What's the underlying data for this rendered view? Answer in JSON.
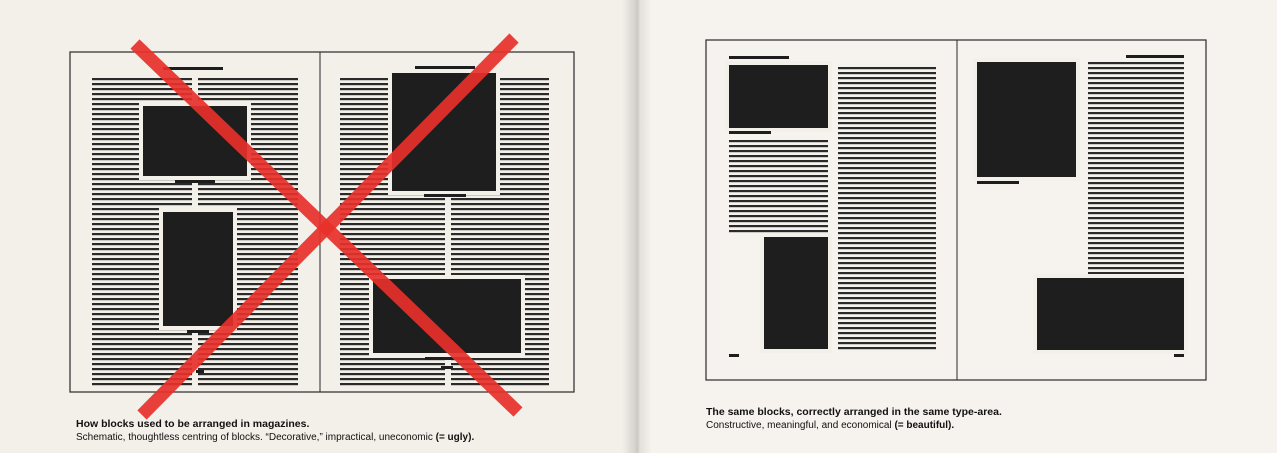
{
  "left_caption": {
    "title": "How blocks used to be arranged in magazines.",
    "body": "Schematic, thoughtless centring of blocks. “Decorative,” impractical, uneconomic",
    "emphasis": "(= ugly)."
  },
  "right_caption": {
    "title": "The same blocks, correctly arranged in the same type-area.",
    "body": "Constructive, meaningful, and economical",
    "emphasis": "(= beautiful)."
  },
  "colors": {
    "cross": "#e8302a",
    "block": "#1e1e1e",
    "paper": "#f3efe9",
    "rule": "#2a2a2a"
  }
}
